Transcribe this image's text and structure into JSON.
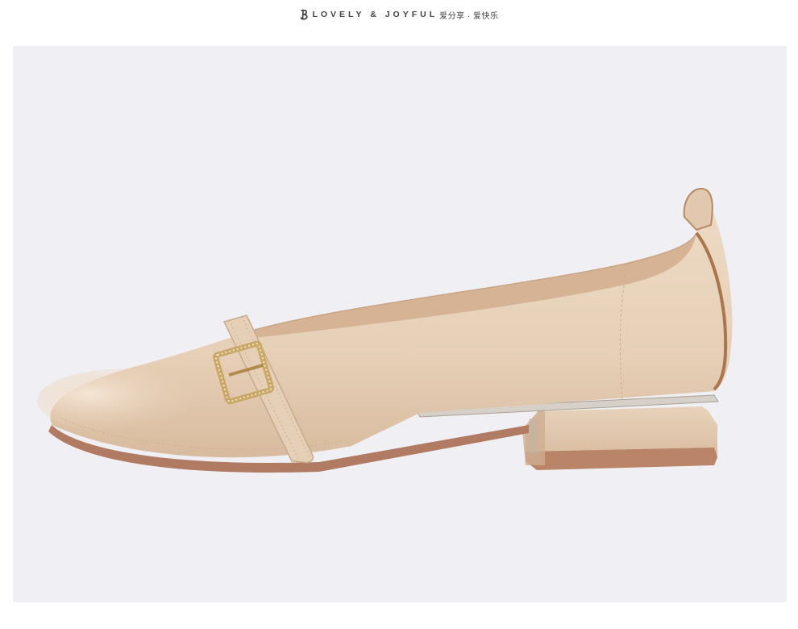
{
  "header": {
    "brand_en": "LOVELY & JOYFUL",
    "brand_cn": "爱分享 · 爱快乐",
    "logo_icon": "script-b-logo-icon"
  },
  "product_photo": {
    "subject": "shoe-photo",
    "colors": {
      "background": "#f0eff3",
      "leather": "#e9d4bd",
      "leather_shadow": "#cdb196",
      "lining": "#d7b596",
      "sole": "#b07b62",
      "heel_plate": "#c9c2b8"
    }
  }
}
